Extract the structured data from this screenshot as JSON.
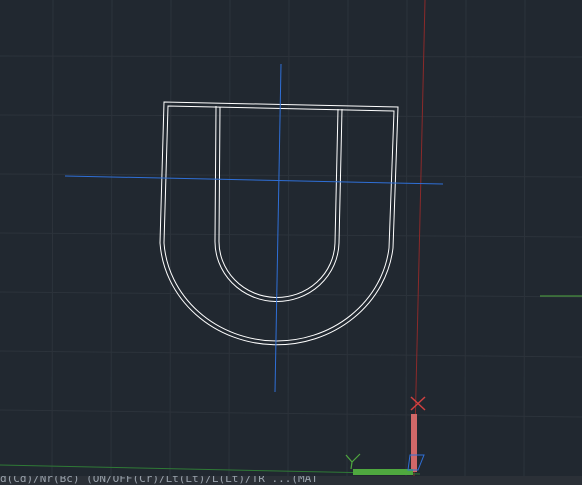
{
  "viewport": {
    "background_color": "#212830",
    "grid_color": "#2c333b"
  },
  "drawing": {
    "object_stroke_color": "#ffffff",
    "centerline_color": "#2f6fd6",
    "ucs_x_line_color": "#8b2a2a",
    "ucs_y_line_color": "#2f7a36"
  },
  "ucs_icon": {
    "x_axis_color": "#d06868",
    "y_axis_color": "#4fa83f",
    "x_marker_glyph": "✕",
    "y_label": "Y",
    "origin_label": "Z"
  },
  "command_line": {
    "text": "d(Cd)/Nr(Bc) (ON/OFF(Cr)/Lt(Lt)/L(Lt)/TR ...(MAT"
  }
}
